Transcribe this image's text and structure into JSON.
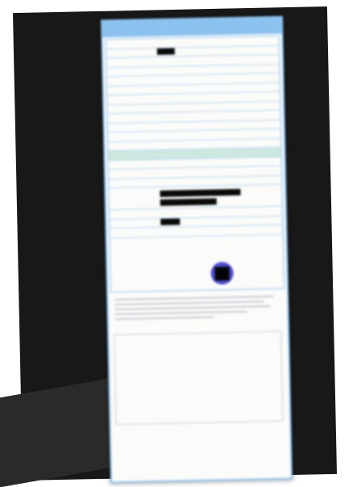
{
  "receipt": {
    "header_title": "",
    "rows": [
      {
        "label": "",
        "value": "",
        "amount": ""
      },
      {
        "label": "",
        "value": "",
        "amount": ""
      },
      {
        "label": "",
        "value": "",
        "amount": ""
      },
      {
        "label": "",
        "value": "",
        "amount": ""
      },
      {
        "label": "",
        "value": "",
        "amount": ""
      },
      {
        "label": "",
        "value": "",
        "amount": ""
      },
      {
        "label": "",
        "value": "",
        "amount": ""
      },
      {
        "label": "",
        "value": "",
        "amount": ""
      },
      {
        "label": "",
        "value": "",
        "amount": ""
      },
      {
        "label": "",
        "value": "",
        "amount": ""
      },
      {
        "label": "",
        "value": "",
        "amount": ""
      },
      {
        "label": "",
        "value": "",
        "amount": ""
      },
      {
        "label": "",
        "value": "",
        "amount": ""
      },
      {
        "label": "",
        "value": "",
        "amount": ""
      },
      {
        "label": "",
        "value": "",
        "amount": ""
      },
      {
        "label": "",
        "value": "",
        "amount": ""
      },
      {
        "label": "",
        "value": "",
        "amount": ""
      },
      {
        "label": "",
        "value": "",
        "amount": ""
      },
      {
        "label": "",
        "value": "",
        "amount": ""
      },
      {
        "label": "",
        "value": "",
        "amount": ""
      }
    ],
    "bottom_title": "",
    "bottom_rows": [
      {
        "name": "",
        "c1": "",
        "c2": "",
        "c3": ""
      },
      {
        "name": "",
        "c1": "",
        "c2": "",
        "c3": ""
      },
      {
        "name": "",
        "c1": "",
        "c2": "",
        "c3": ""
      },
      {
        "name": "",
        "c1": "",
        "c2": "",
        "c3": ""
      },
      {
        "name": "",
        "c1": "",
        "c2": "",
        "c3": ""
      },
      {
        "name": "",
        "c1": "",
        "c2": "",
        "c3": ""
      },
      {
        "name": "",
        "c1": "",
        "c2": "",
        "c3": ""
      },
      {
        "name": "",
        "c1": "",
        "c2": "",
        "c3": ""
      }
    ]
  },
  "colors": {
    "accent": "#8cc2ef",
    "highlight": "#cde8de",
    "stamp": "#2b2bd0"
  }
}
